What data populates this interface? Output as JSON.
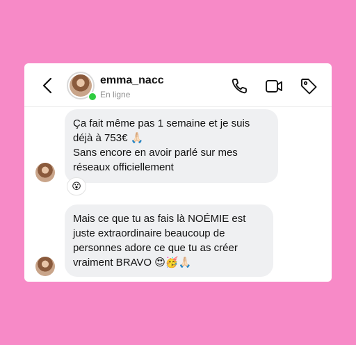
{
  "header": {
    "username": "emma_nacc",
    "status": "En ligne",
    "icons": [
      "back-icon",
      "phone-icon",
      "video-icon",
      "tag-icon"
    ]
  },
  "messages": [
    {
      "text": "Ça fait même pas 1 semaine et je suis déjà à 753€ 🙏🏻\nSans encore en avoir parlé sur mes réseaux officiellement",
      "reaction": "😮"
    },
    {
      "text": "Mais ce que tu as fais là NOÉMIE est juste extraordinaire beaucoup de personnes adore ce que tu as créer vraiment BRAVO 😍🥳🙏🏻"
    }
  ],
  "colors": {
    "background": "#f78ac7",
    "bubble": "#eff0f2",
    "online": "#2ecc40"
  }
}
